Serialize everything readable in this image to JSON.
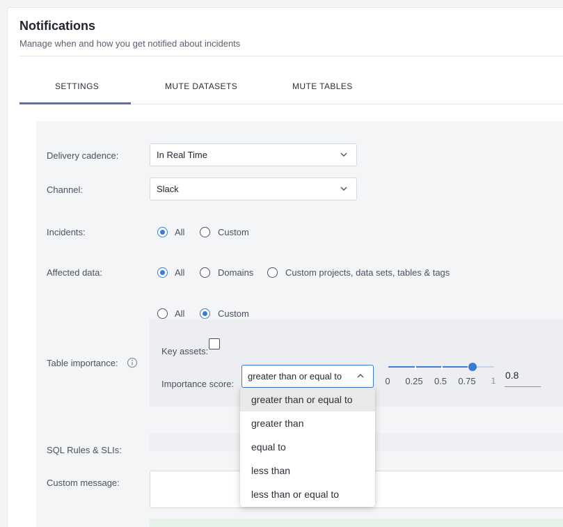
{
  "header": {
    "title": "Notifications",
    "subtitle": "Manage when and how you get notified about incidents"
  },
  "tabs": [
    {
      "label": "SETTINGS",
      "active": true
    },
    {
      "label": "MUTE DATASETS",
      "active": false
    },
    {
      "label": "MUTE TABLES",
      "active": false
    }
  ],
  "form": {
    "delivery_cadence": {
      "label": "Delivery cadence:",
      "value": "In Real Time"
    },
    "channel": {
      "label": "Channel:",
      "value": "Slack"
    },
    "incidents": {
      "label": "Incidents:",
      "options": [
        "All",
        "Custom"
      ],
      "selected": "All"
    },
    "affected_data": {
      "label": "Affected data:",
      "options": [
        "All",
        "Domains",
        "Custom projects, data sets, tables & tags"
      ],
      "selected": "All"
    },
    "table_importance": {
      "label": "Table importance:",
      "options": [
        "All",
        "Custom"
      ],
      "selected": "Custom",
      "key_assets_label": "Key assets:",
      "key_assets_checked": false,
      "importance_score_label": "Importance score:",
      "operator": "greater than or equal to",
      "slider_ticks": [
        "0",
        "0.25",
        "0.5",
        "0.75",
        "1"
      ],
      "score_value": "0.8",
      "score_fraction": 0.8
    },
    "sql_rules": {
      "label": "SQL Rules & SLIs:"
    },
    "custom_message": {
      "label": "Custom message:",
      "value": ""
    }
  },
  "operator_dropdown": {
    "items": [
      "greater than or equal to",
      "greater than",
      "equal to",
      "less than",
      "less than or equal to"
    ],
    "selected_index": 0
  },
  "colors": {
    "accent": "#3a7bd5",
    "tab_underline": "#5d6bb0",
    "panel_bg": "#f4f5f7"
  },
  "icons": {
    "select_chevron": "chevron-down-icon",
    "operator_chevron": "chevron-up-icon",
    "info": "info-icon"
  }
}
